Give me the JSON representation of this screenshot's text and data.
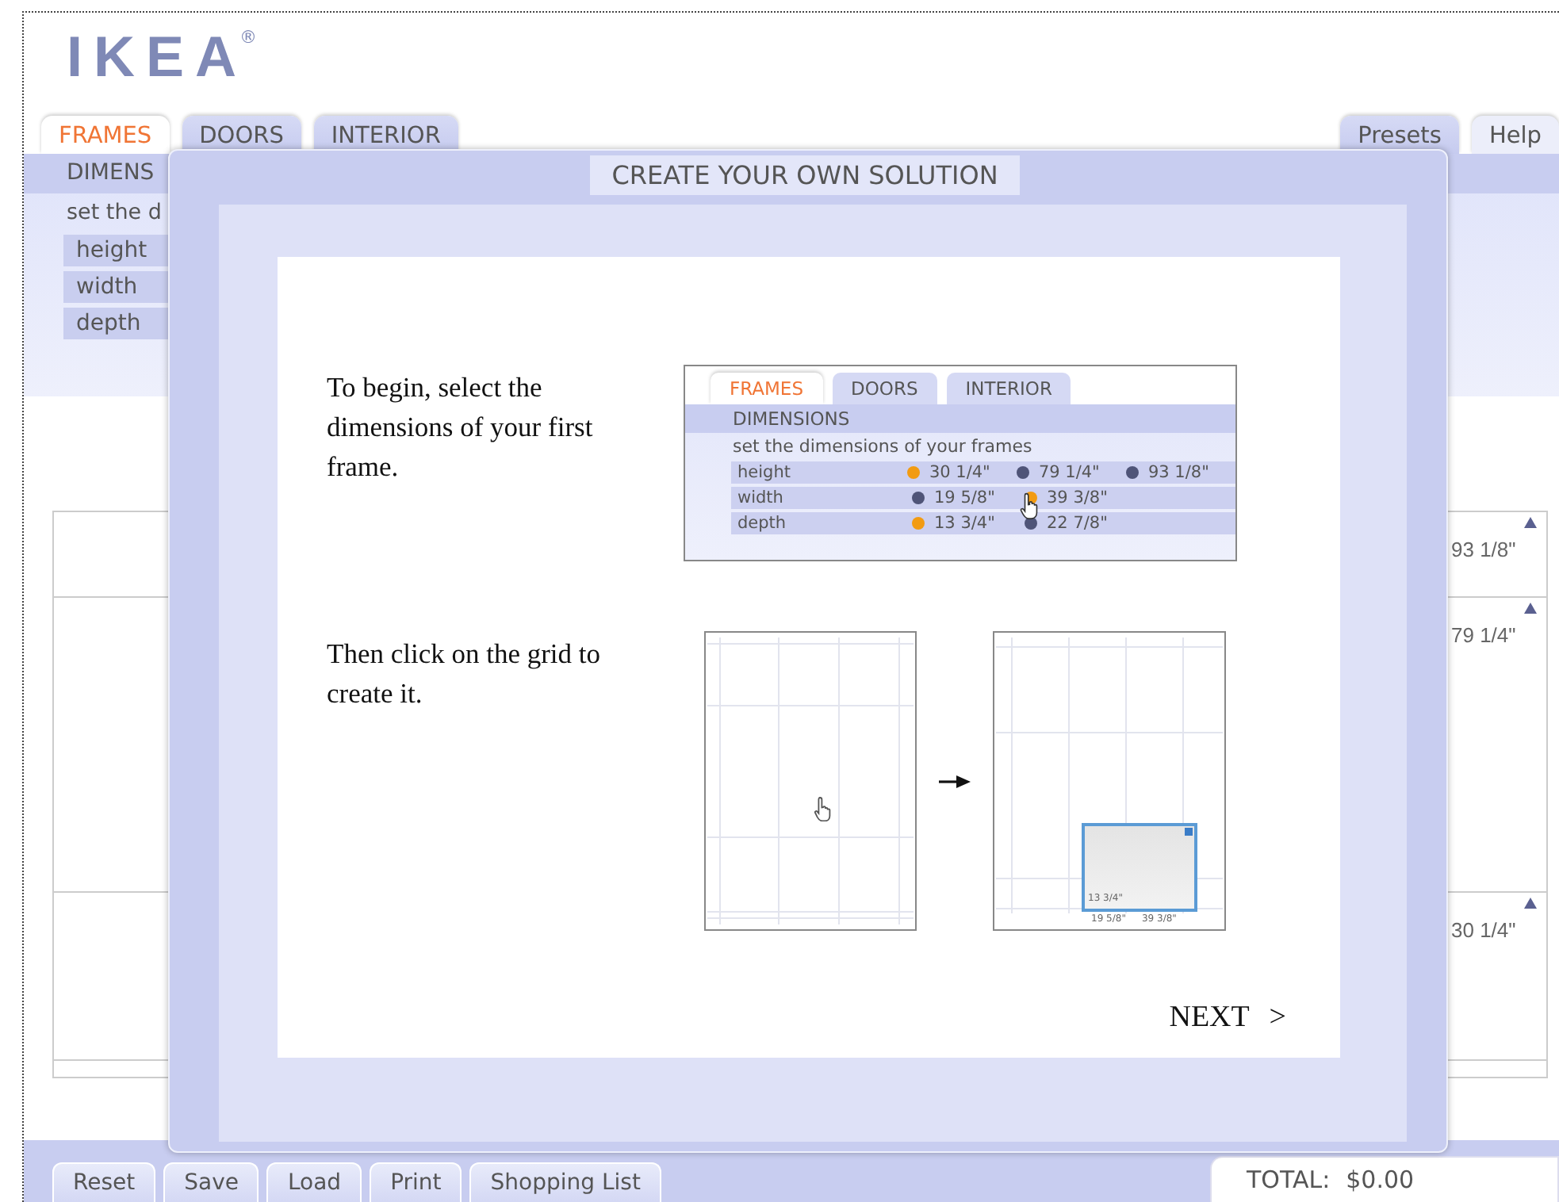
{
  "logo": {
    "text": "IKEA",
    "mark": "®"
  },
  "tabs": [
    {
      "label": "FRAMES",
      "selected": true
    },
    {
      "label": "DOORS",
      "selected": false
    },
    {
      "label": "INTERIOR",
      "selected": false
    }
  ],
  "side_tabs": [
    {
      "label": "Presets",
      "selected": false
    },
    {
      "label": "Help",
      "selected": true
    }
  ],
  "panel": {
    "heading": "DIMENS",
    "hint": "set the d",
    "fields": [
      "height",
      "width",
      "depth"
    ]
  },
  "grid": {
    "markers": [
      "93 1/8\"",
      "79 1/4\"",
      "30 1/4\""
    ]
  },
  "buttons": [
    "Reset",
    "Save",
    "Load",
    "Print",
    "Shopping List"
  ],
  "total": {
    "label": "TOTAL:",
    "value": "$0.00"
  },
  "dialog": {
    "title": "CREATE YOUR OWN SOLUTION",
    "steps": [
      "To begin, select the dimensions of your first frame.",
      "Then click on the grid to create it."
    ],
    "preview": {
      "tabs": [
        {
          "label": "FRAMES",
          "selected": true
        },
        {
          "label": "DOORS",
          "selected": false
        },
        {
          "label": "INTERIOR",
          "selected": false
        }
      ],
      "heading": "DIMENSIONS",
      "hint": "set the dimensions of your frames",
      "rows": [
        {
          "label": "height",
          "options": [
            {
              "value": "30 1/4\"",
              "selected": true
            },
            {
              "value": "79 1/4\"",
              "selected": false
            },
            {
              "value": "93 1/8\"",
              "selected": false
            }
          ]
        },
        {
          "label": "width",
          "options": [
            {
              "value": "19 5/8\"",
              "selected": false
            },
            {
              "value": "39 3/8\"",
              "selected": true
            }
          ]
        },
        {
          "label": "depth",
          "options": [
            {
              "value": "13 3/4\"",
              "selected": true
            },
            {
              "value": "22 7/8\"",
              "selected": false
            }
          ]
        }
      ]
    },
    "grid_labels": {
      "frame": "13 3/4\"",
      "bottom": [
        "19 5/8\"",
        "39 3/8\""
      ]
    },
    "next": "NEXT >"
  }
}
